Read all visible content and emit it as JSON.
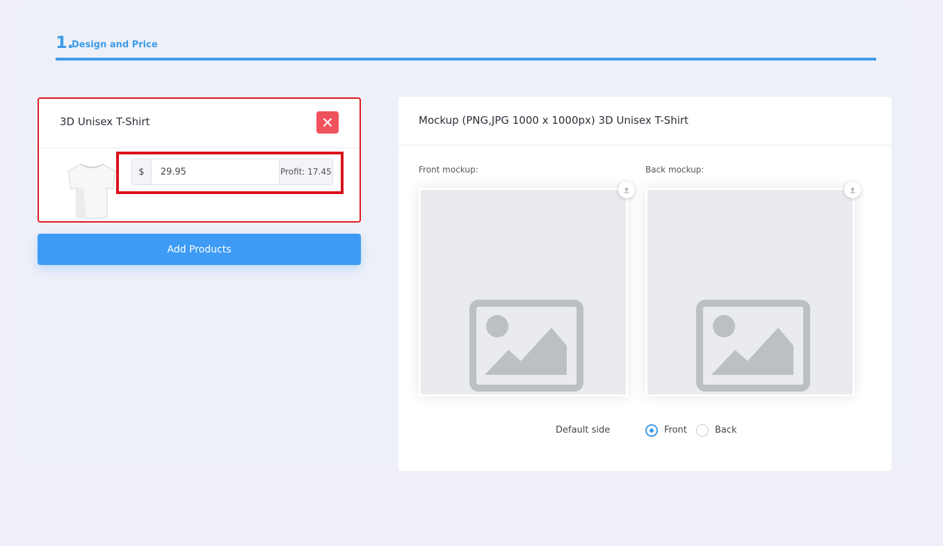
{
  "step": {
    "number": "1.",
    "title": "Design and Price"
  },
  "product": {
    "title": "3D Unisex T-Shirt",
    "currency_symbol": "$",
    "price_value": "29.95",
    "profit_label": "Profit: 17.45",
    "remove_icon": "close-icon",
    "thumbnail": "tshirt-image"
  },
  "add_products_label": "Add Products",
  "mockup": {
    "title": "Mockup (PNG,JPG 1000 x 1000px) 3D Unisex T-Shirt",
    "front_label": "Front mockup:",
    "back_label": "Back mockup:",
    "placeholder_icon": "image-placeholder-icon",
    "upload_icon": "upload-icon",
    "default_side_label": "Default side",
    "options": [
      "Front",
      "Back"
    ],
    "selected": "Front"
  },
  "colors": {
    "accent": "#3d9be9",
    "button": "#3d9bf5",
    "danger": "#f0525c",
    "highlight": "#d9111a"
  }
}
